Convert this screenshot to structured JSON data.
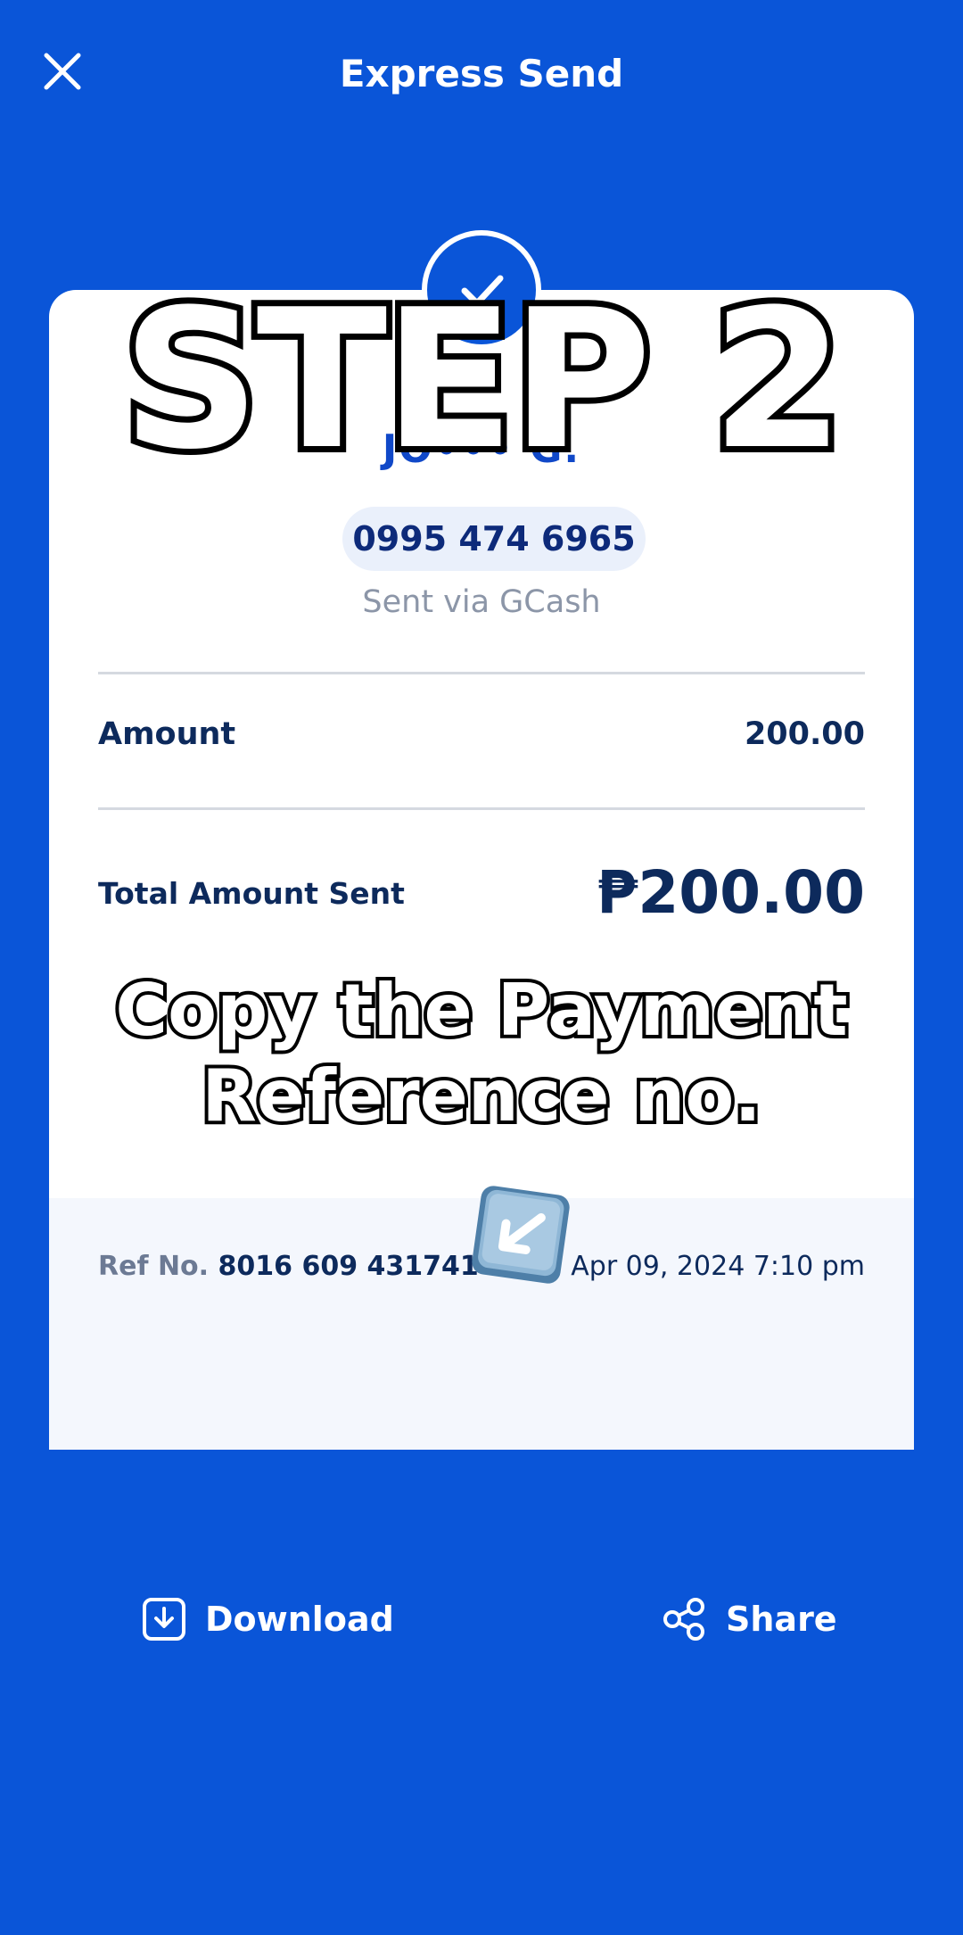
{
  "header": {
    "title": "Express Send",
    "close_icon": "close-icon"
  },
  "receipt": {
    "recipient_name": "JO••• G.",
    "phone": "0995 474 6965",
    "sent_via": "Sent via GCash",
    "amount_label": "Amount",
    "amount_value": "200.00",
    "total_label": "Total Amount Sent",
    "total_value": "₱200.00",
    "ref_label": "Ref No.",
    "ref_number": "8016 609 431741",
    "date": "Apr 09, 2024 7:10 pm"
  },
  "overlay": {
    "step_text": "STEP 2",
    "caption_line1": "Copy the Payment",
    "caption_line2": "Reference no.",
    "pointer_icon": "down-left-arrow-icon"
  },
  "actions": {
    "download_label": "Download",
    "share_label": "Share"
  },
  "colors": {
    "background": "#0a55d8",
    "card": "#ffffff",
    "text_dark": "#0d2a5c",
    "accent": "#1048c8"
  }
}
